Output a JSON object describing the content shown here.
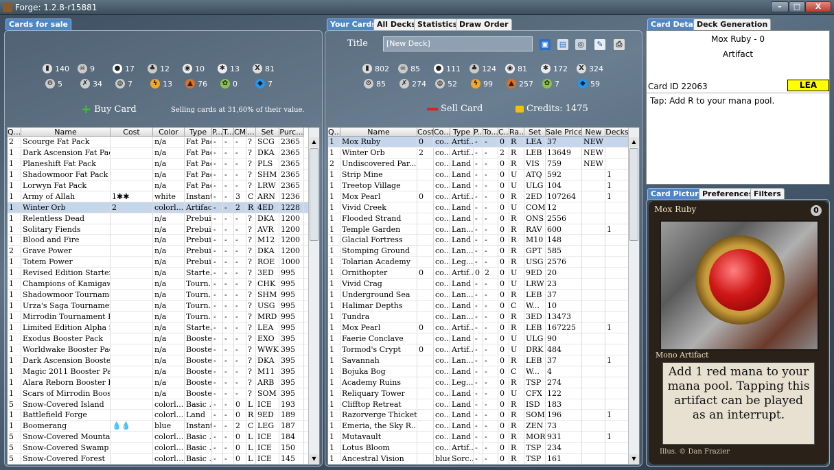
{
  "window": {
    "title": "Forge: 1.2.8-r15881",
    "min": "–",
    "max": "□",
    "close": "X"
  },
  "shop": {
    "tab": "Cards for sale",
    "buy_label": "Buy Card",
    "selling_text": "Selling cards at 31,60% of their value.",
    "counters_row1": [
      {
        "icon": "card-icon",
        "color": "#ddd",
        "value": "140"
      },
      {
        "icon": "skull-icon",
        "color": "#ccc",
        "value": "9"
      },
      {
        "icon": "water-drop-icon",
        "color": "#fff",
        "value": "17"
      },
      {
        "icon": "tree-icon",
        "color": "#ccc",
        "value": "12"
      },
      {
        "icon": "fire-icon",
        "color": "#eee",
        "value": "10"
      },
      {
        "icon": "sun-icon",
        "color": "#eee",
        "value": "13"
      },
      {
        "icon": "x-icon",
        "color": "#ddd",
        "value": "81"
      }
    ],
    "counters_row2": [
      {
        "icon": "gear-icon",
        "color": "#ccc",
        "value": "5"
      },
      {
        "icon": "sword-icon",
        "color": "#ccc",
        "value": "34"
      },
      {
        "icon": "mask-icon",
        "color": "#ccc",
        "value": "7"
      },
      {
        "icon": "bolt-icon",
        "color": "#f5a623",
        "value": "13"
      },
      {
        "icon": "land-icon",
        "color": "#e07020",
        "value": "76"
      },
      {
        "icon": "creature-icon",
        "color": "#8bc34a",
        "value": "0"
      },
      {
        "icon": "paw-icon",
        "color": "#2196f3",
        "value": "7"
      }
    ],
    "columns": [
      "Q...",
      "Name",
      "Cost",
      "Color",
      "Type",
      "P...",
      "T...",
      "CMC",
      "...",
      "Set",
      "Purc..."
    ],
    "rows": [
      [
        "2",
        "Scourge Fat Pack",
        "",
        "n/a",
        "Fat Pack",
        "-",
        "-",
        "-",
        "?",
        "SCG",
        "2365"
      ],
      [
        "1",
        "Dark Ascension Fat Pack",
        "",
        "n/a",
        "Fat Pack",
        "-",
        "-",
        "-",
        "?",
        "DKA",
        "2365"
      ],
      [
        "1",
        "Planeshift Fat Pack",
        "",
        "n/a",
        "Fat Pack",
        "-",
        "-",
        "-",
        "?",
        "PLS",
        "2365"
      ],
      [
        "1",
        "Shadowmoor Fat Pack",
        "",
        "n/a",
        "Fat Pack",
        "-",
        "-",
        "-",
        "?",
        "SHM",
        "2365"
      ],
      [
        "1",
        "Lorwyn Fat Pack",
        "",
        "n/a",
        "Fat Pack",
        "-",
        "-",
        "-",
        "?",
        "LRW",
        "2365"
      ],
      [
        "1",
        "Army of Allah",
        "1✱✱",
        "white",
        "Instant",
        "-",
        "-",
        "3",
        "C",
        "ARN",
        "1236"
      ],
      [
        "1",
        "Winter Orb",
        "2",
        "colorl...",
        "Artifact",
        "-",
        "-",
        "2",
        "R",
        "4ED",
        "1228"
      ],
      [
        "1",
        "Relentless Dead",
        "",
        "n/a",
        "Prebui...",
        "-",
        "-",
        "-",
        "?",
        "DKA",
        "1200"
      ],
      [
        "1",
        "Solitary Fiends",
        "",
        "n/a",
        "Prebui...",
        "-",
        "-",
        "-",
        "?",
        "AVR",
        "1200"
      ],
      [
        "1",
        "Blood and Fire",
        "",
        "n/a",
        "Prebui...",
        "-",
        "-",
        "-",
        "?",
        "M12",
        "1200"
      ],
      [
        "2",
        "Grave Power",
        "",
        "n/a",
        "Prebui...",
        "-",
        "-",
        "-",
        "?",
        "DKA",
        "1200"
      ],
      [
        "1",
        "Totem Power",
        "",
        "n/a",
        "Prebui...",
        "-",
        "-",
        "-",
        "?",
        "ROE",
        "1000"
      ],
      [
        "1",
        "Revised Edition Starter ...",
        "",
        "n/a",
        "Starte...",
        "-",
        "-",
        "-",
        "?",
        "3ED",
        "995"
      ],
      [
        "1",
        "Champions of Kamigaw...",
        "",
        "n/a",
        "Tourn...",
        "-",
        "-",
        "-",
        "?",
        "CHK",
        "995"
      ],
      [
        "1",
        "Shadowmoor Tourname...",
        "",
        "n/a",
        "Tourn...",
        "-",
        "-",
        "-",
        "?",
        "SHM",
        "995"
      ],
      [
        "1",
        "Urza's Saga Tournamen...",
        "",
        "n/a",
        "Tourn...",
        "-",
        "-",
        "-",
        "?",
        "USG",
        "995"
      ],
      [
        "1",
        "Mirrodin Tournament P...",
        "",
        "n/a",
        "Tourn...",
        "-",
        "-",
        "-",
        "?",
        "MRD",
        "995"
      ],
      [
        "1",
        "Limited Edition Alpha St...",
        "",
        "n/a",
        "Starte...",
        "-",
        "-",
        "-",
        "?",
        "LEA",
        "995"
      ],
      [
        "1",
        "Exodus Booster Pack",
        "",
        "n/a",
        "Booste...",
        "-",
        "-",
        "-",
        "?",
        "EXO",
        "395"
      ],
      [
        "1",
        "Worldwake Booster Pack",
        "",
        "n/a",
        "Booste...",
        "-",
        "-",
        "-",
        "?",
        "WWK",
        "395"
      ],
      [
        "1",
        "Dark Ascension Booster...",
        "",
        "n/a",
        "Booste...",
        "-",
        "-",
        "-",
        "?",
        "DKA",
        "395"
      ],
      [
        "1",
        "Magic 2011 Booster Pack",
        "",
        "n/a",
        "Booste...",
        "-",
        "-",
        "-",
        "?",
        "M11",
        "395"
      ],
      [
        "1",
        "Alara Reborn Booster P...",
        "",
        "n/a",
        "Booste...",
        "-",
        "-",
        "-",
        "?",
        "ARB",
        "395"
      ],
      [
        "1",
        "Scars of Mirrodin Boost...",
        "",
        "n/a",
        "Booste...",
        "-",
        "-",
        "-",
        "?",
        "SOM",
        "395"
      ],
      [
        "5",
        "Snow-Covered Island",
        "",
        "colorl...",
        "Basic ...",
        "-",
        "-",
        "0",
        "L",
        "ICE",
        "193"
      ],
      [
        "1",
        "Battlefield Forge",
        "",
        "colorl...",
        "Land",
        "-",
        "-",
        "0",
        "R",
        "9ED",
        "189"
      ],
      [
        "1",
        "Boomerang",
        "💧💧",
        "blue",
        "Instant",
        "-",
        "-",
        "2",
        "C",
        "LEG",
        "187"
      ],
      [
        "5",
        "Snow-Covered Mountain",
        "",
        "colorl...",
        "Basic ...",
        "-",
        "-",
        "0",
        "L",
        "ICE",
        "184"
      ],
      [
        "5",
        "Snow-Covered Swamp",
        "",
        "colorl...",
        "Basic ...",
        "-",
        "-",
        "0",
        "L",
        "ICE",
        "150"
      ],
      [
        "5",
        "Snow-Covered Forest",
        "",
        "colorl...",
        "Basic ...",
        "-",
        "-",
        "0",
        "L",
        "ICE",
        "145"
      ]
    ]
  },
  "deck": {
    "tabs": [
      "Your Cards",
      "All Decks",
      "Statistics",
      "Draw Order"
    ],
    "title_label": "Title",
    "title_value": "[New Deck]",
    "sell_label": "Sell Card",
    "credits": "Credits: 1475",
    "counters_row1": [
      {
        "icon": "card-icon",
        "color": "#ddd",
        "value": "802"
      },
      {
        "icon": "skull-icon",
        "color": "#ccc",
        "value": "85"
      },
      {
        "icon": "water-drop-icon",
        "color": "#fff",
        "value": "111"
      },
      {
        "icon": "tree-icon",
        "color": "#ccc",
        "value": "124"
      },
      {
        "icon": "fire-icon",
        "color": "#eee",
        "value": "81"
      },
      {
        "icon": "sun-icon",
        "color": "#eee",
        "value": "172"
      },
      {
        "icon": "x-icon",
        "color": "#ddd",
        "value": "324"
      }
    ],
    "counters_row2": [
      {
        "icon": "gear-icon",
        "color": "#ccc",
        "value": "85"
      },
      {
        "icon": "sword-icon",
        "color": "#ccc",
        "value": "274"
      },
      {
        "icon": "mask-icon",
        "color": "#ccc",
        "value": "52"
      },
      {
        "icon": "bolt-icon",
        "color": "#f5a623",
        "value": "99"
      },
      {
        "icon": "land-icon",
        "color": "#e07020",
        "value": "257"
      },
      {
        "icon": "creature-icon",
        "color": "#8bc34a",
        "value": "7"
      },
      {
        "icon": "paw-icon",
        "color": "#2196f3",
        "value": "59"
      }
    ],
    "columns": [
      "Q...",
      "Name",
      "Cost",
      "Co...",
      "Type",
      "P...",
      "To...",
      "C...",
      "Ra...",
      "Set",
      "Sale Price",
      "New",
      "Decks"
    ],
    "rows": [
      [
        "1",
        "Mox Ruby",
        "0",
        "co...",
        "Artif...",
        "-",
        "-",
        "0",
        "R",
        "LEA",
        "37",
        "NEW",
        ""
      ],
      [
        "1",
        "Winter Orb",
        "2",
        "co...",
        "Artif...",
        "-",
        "-",
        "2",
        "R",
        "LEB",
        "13649",
        "NEW",
        ""
      ],
      [
        "2",
        "Undiscovered Par...",
        "",
        "co...",
        "Land",
        "-",
        "-",
        "0",
        "R",
        "VIS",
        "759",
        "NEW",
        ""
      ],
      [
        "1",
        "Strip Mine",
        "",
        "co...",
        "Land",
        "-",
        "-",
        "0",
        "U",
        "ATQ",
        "592",
        "",
        "1"
      ],
      [
        "1",
        "Treetop Village",
        "",
        "co...",
        "Land",
        "-",
        "-",
        "0",
        "U",
        "ULG",
        "104",
        "",
        "1"
      ],
      [
        "1",
        "Mox Pearl",
        "0",
        "co...",
        "Artif...",
        "-",
        "-",
        "0",
        "R",
        "2ED",
        "107264",
        "",
        "1"
      ],
      [
        "1",
        "Vivid Creek",
        "",
        "co...",
        "Land",
        "-",
        "-",
        "0",
        "U",
        "COM",
        "12",
        "",
        ""
      ],
      [
        "1",
        "Flooded Strand",
        "",
        "co...",
        "Land",
        "-",
        "-",
        "0",
        "R",
        "ONS",
        "2556",
        "",
        ""
      ],
      [
        "1",
        "Temple Garden",
        "",
        "co...",
        "Lan...",
        "-",
        "-",
        "0",
        "R",
        "RAV",
        "600",
        "",
        "1"
      ],
      [
        "1",
        "Glacial Fortress",
        "",
        "co...",
        "Land",
        "-",
        "-",
        "0",
        "R",
        "M10",
        "148",
        "",
        ""
      ],
      [
        "1",
        "Stomping Ground",
        "",
        "co...",
        "Lan...",
        "-",
        "-",
        "0",
        "R",
        "GPT",
        "585",
        "",
        ""
      ],
      [
        "1",
        "Tolarian Academy",
        "",
        "co...",
        "Leg...",
        "-",
        "-",
        "0",
        "R",
        "USG",
        "2576",
        "",
        ""
      ],
      [
        "1",
        "Ornithopter",
        "0",
        "co...",
        "Artif...",
        "0",
        "2",
        "0",
        "U",
        "9ED",
        "20",
        "",
        ""
      ],
      [
        "1",
        "Vivid Crag",
        "",
        "co...",
        "Land",
        "-",
        "-",
        "0",
        "U",
        "LRW",
        "23",
        "",
        ""
      ],
      [
        "1",
        "Underground Sea",
        "",
        "co...",
        "Lan...",
        "-",
        "-",
        "0",
        "R",
        "LEB",
        "37",
        "",
        ""
      ],
      [
        "1",
        "Halimar Depths",
        "",
        "co...",
        "Land",
        "-",
        "-",
        "0",
        "C",
        "W...",
        "10",
        "",
        ""
      ],
      [
        "1",
        "Tundra",
        "",
        "co...",
        "Lan...",
        "-",
        "-",
        "0",
        "R",
        "3ED",
        "13473",
        "",
        ""
      ],
      [
        "1",
        "Mox Pearl",
        "0",
        "co...",
        "Artif...",
        "-",
        "-",
        "0",
        "R",
        "LEB",
        "167225",
        "",
        "1"
      ],
      [
        "1",
        "Faerie Conclave",
        "",
        "co...",
        "Land",
        "-",
        "-",
        "0",
        "U",
        "ULG",
        "90",
        "",
        ""
      ],
      [
        "1",
        "Tormod's Crypt",
        "0",
        "co...",
        "Artif...",
        "-",
        "-",
        "0",
        "U",
        "DRK",
        "484",
        "",
        ""
      ],
      [
        "1",
        "Savannah",
        "",
        "co...",
        "Lan...",
        "-",
        "-",
        "0",
        "R",
        "LEB",
        "37",
        "",
        "1"
      ],
      [
        "1",
        "Bojuka Bog",
        "",
        "co...",
        "Land",
        "-",
        "-",
        "0",
        "C",
        "W...",
        "4",
        "",
        ""
      ],
      [
        "1",
        "Academy Ruins",
        "",
        "co...",
        "Leg...",
        "-",
        "-",
        "0",
        "R",
        "TSP",
        "274",
        "",
        ""
      ],
      [
        "1",
        "Reliquary Tower",
        "",
        "co...",
        "Land",
        "-",
        "-",
        "0",
        "U",
        "CFX",
        "122",
        "",
        ""
      ],
      [
        "1",
        "Clifftop Retreat",
        "",
        "co...",
        "Land",
        "-",
        "-",
        "0",
        "R",
        "ISD",
        "183",
        "",
        ""
      ],
      [
        "1",
        "Razorverge Thicket",
        "",
        "co...",
        "Land",
        "-",
        "-",
        "0",
        "R",
        "SOM",
        "196",
        "",
        "1"
      ],
      [
        "1",
        "Emeria, the Sky R...",
        "",
        "co...",
        "Land",
        "-",
        "-",
        "0",
        "R",
        "ZEN",
        "73",
        "",
        ""
      ],
      [
        "1",
        "Mutavault",
        "",
        "co...",
        "Land",
        "-",
        "-",
        "0",
        "R",
        "MOR",
        "931",
        "",
        "1"
      ],
      [
        "1",
        "Lotus Bloom",
        "",
        "co...",
        "Artif...",
        "-",
        "-",
        "0",
        "R",
        "TSP",
        "234",
        "",
        ""
      ],
      [
        "1",
        "Ancestral Vision",
        "",
        "blue",
        "Sorc...",
        "-",
        "-",
        "0",
        "R",
        "TSP",
        "161",
        "",
        ""
      ]
    ]
  },
  "detail": {
    "tabs": [
      "Card Detail",
      "Deck Generation"
    ],
    "name": "Mox Ruby - 0",
    "type": "Artifact",
    "card_id": "Card ID  22063",
    "set": "LEA",
    "set_color": "#ffff00",
    "text": "Tap: Add R to your mana pool."
  },
  "picture": {
    "tabs": [
      "Card Picture",
      "Preferences",
      "Filters"
    ],
    "card_name": "Mox Ruby",
    "cost": "0",
    "type_line": "Mono Artifact",
    "rules": "Add 1 red mana to your mana pool. Tapping this artifact can be played as an interrupt.",
    "artist": "Illus. © Dan Frazier"
  }
}
